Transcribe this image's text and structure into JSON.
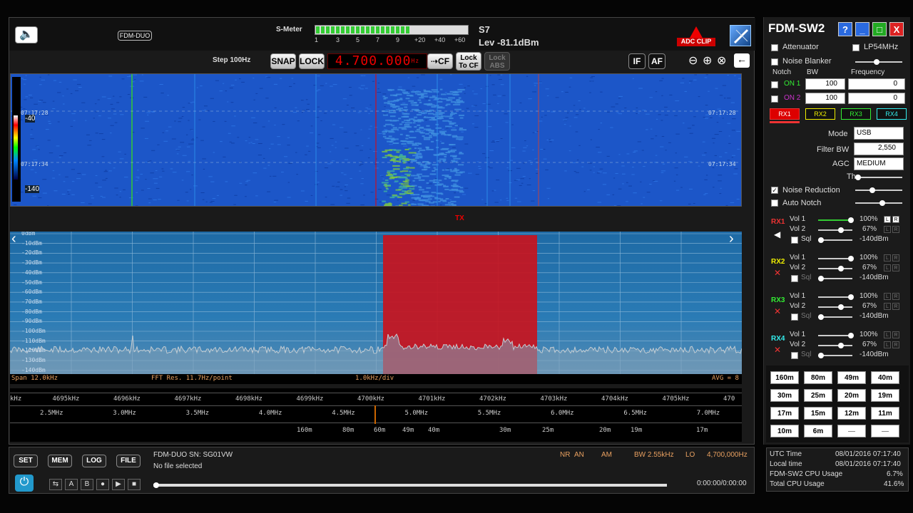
{
  "window": {
    "title": "FDM-SW2",
    "controls": [
      "?",
      "_",
      "□",
      "X"
    ]
  },
  "topbar": {
    "device": "FDM-DUO",
    "smeter_label": "S-Meter",
    "smeter_scale": [
      "1",
      "3",
      "5",
      "7",
      "9",
      "+20",
      "+40",
      "+60"
    ],
    "smeter_level": 0.62,
    "s_reading": "S7",
    "level": "Lev -81.1dBm",
    "adc_clip": "ADC CLIP",
    "step": "Step 100Hz",
    "snap": "SNAP",
    "lock": "LOCK",
    "frequency": "4.700.000",
    "freq_unit": "Hz",
    "cf": "CF",
    "lock_to_cf": "Lock To CF",
    "lock_abs": "Lock ABS",
    "if_btn": "IF",
    "af_btn": "AF"
  },
  "waterfall": {
    "scale_top": "-40",
    "scale_bottom": "-140",
    "time1": "07:17:28",
    "time2": "07:17:34",
    "tx_label": "TX"
  },
  "spectrum": {
    "db_labels": [
      "0dBm",
      "-10dBm",
      "-20dBm",
      "-30dBm",
      "-40dBm",
      "-50dBm",
      "-60dBm",
      "-70dBm",
      "-80dBm",
      "-90dBm",
      "-100dBm",
      "-110dBm",
      "-120dBm",
      "-130dBm",
      "-140dBm"
    ],
    "span": "Span 12.0kHz",
    "fft": "FFT Res. 11.7Hz/point",
    "div": "1.0kHz/div",
    "avg": "AVG = 8"
  },
  "scales": {
    "khz": [
      "kHz",
      "4695kHz",
      "4696kHz",
      "4697kHz",
      "4698kHz",
      "4699kHz",
      "4700kHz",
      "4701kHz",
      "4702kHz",
      "4703kHz",
      "4704kHz",
      "4705kHz",
      "470"
    ],
    "mhz": [
      "2.5MHz",
      "3.0MHz",
      "3.5MHz",
      "4.0MHz",
      "4.5MHz",
      "5.0MHz",
      "5.5MHz",
      "6.0MHz",
      "6.5MHz",
      "7.0MHz"
    ],
    "bands": [
      "160m",
      "80m",
      "60m",
      "49m",
      "40m",
      "30m",
      "25m",
      "20m",
      "19m",
      "17m"
    ]
  },
  "bottom": {
    "set": "SET",
    "mem": "MEM",
    "log": "LOG",
    "file": "FILE",
    "serial": "FDM-DUO SN: SG01VW",
    "file_status": "No file selected",
    "nr": "NR",
    "an": "AN",
    "am": "AM",
    "bw": "BW 2.55kHz",
    "lo": "LO",
    "lo_value": "4,700,000Hz",
    "time": "0:00:00/0:00:00",
    "transport": [
      "⇆",
      "A",
      "B",
      "●",
      "▶",
      "■"
    ]
  },
  "side": {
    "attenuator": "Attenuator",
    "lp54": "LP54MHz",
    "noise_blanker": "Noise Blanker",
    "notch": "Notch",
    "bw": "BW",
    "frequency": "Frequency",
    "on1": "ON 1",
    "on2": "ON 2",
    "bw1": "100",
    "bw2": "100",
    "f1": "0",
    "f2": "0",
    "rx_tabs": [
      "RX1",
      "RX2",
      "RX3",
      "RX4"
    ],
    "mode_lbl": "Mode",
    "mode": "USB",
    "filter_lbl": "Filter BW",
    "filter": "2,550",
    "agc_lbl": "AGC",
    "agc": "MEDIUM",
    "thr": "Thr",
    "noise_reduction": "Noise Reduction",
    "auto_notch": "Auto Notch",
    "vol1": "Vol 1",
    "vol2": "Vol 2",
    "sql": "Sql",
    "rx": [
      {
        "name": "RX1",
        "color": "#e33",
        "v1": "100%",
        "v2": "67%",
        "sq": "-140dBm"
      },
      {
        "name": "RX2",
        "color": "#ee0",
        "v1": "100%",
        "v2": "67%",
        "sq": "-140dBm"
      },
      {
        "name": "RX3",
        "color": "#3e3",
        "v1": "100%",
        "v2": "67%",
        "sq": "-140dBm"
      },
      {
        "name": "RX4",
        "color": "#3ee",
        "v1": "100%",
        "v2": "67%",
        "sq": "-140dBm"
      }
    ],
    "lr": [
      "L",
      "R"
    ]
  },
  "bands": {
    "rows": [
      [
        "160m",
        "80m",
        "49m",
        "40m"
      ],
      [
        "30m",
        "25m",
        "20m",
        "19m"
      ],
      [
        "17m",
        "15m",
        "12m",
        "11m"
      ],
      [
        "10m",
        "6m",
        "—",
        "—"
      ]
    ]
  },
  "status": {
    "utc_lbl": "UTC Time",
    "utc": "08/01/2016 07:17:40",
    "local_lbl": "Local time",
    "local": "08/01/2016 07:17:40",
    "cpu_lbl": "FDM-SW2 CPU Usage",
    "cpu": "6.7%",
    "total_lbl": "Total CPU Usage",
    "total": "41.6%"
  },
  "colors": {
    "waterfall_bg": "#1c56c8",
    "filter_band": "#c8141e",
    "rx1": "#e33",
    "rx2": "#ee0",
    "rx3": "#3e3",
    "rx4": "#3ee"
  }
}
